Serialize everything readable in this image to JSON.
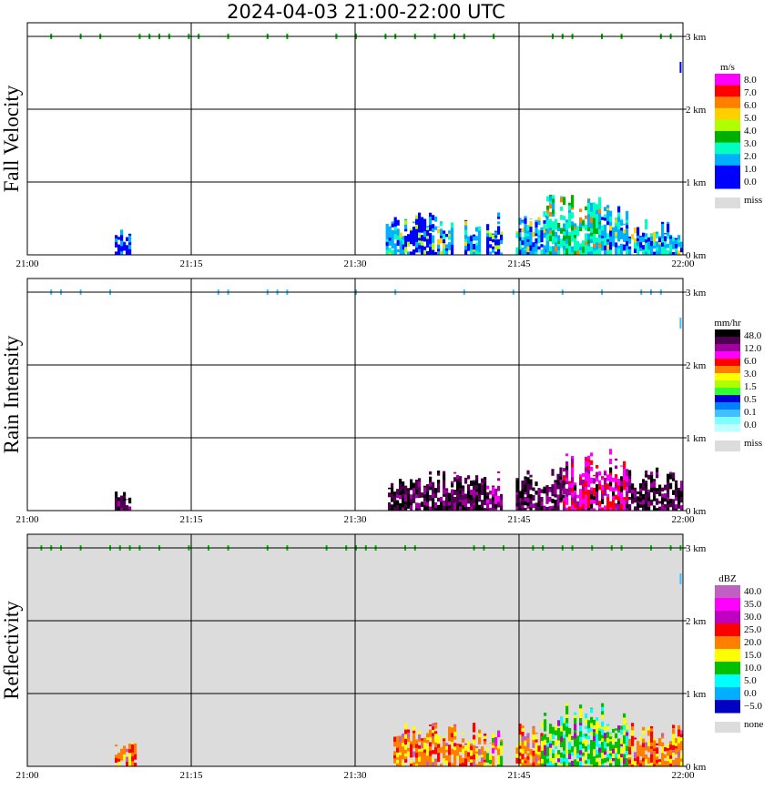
{
  "title": "2024-04-03  21:00-22:00 UTC",
  "colors": {
    "missing_gray": "#dcdcdc",
    "panel_border": "#000000",
    "background": "#ffffff"
  },
  "chart_data": [
    {
      "type": "heatmap",
      "title": "Fall Velocity",
      "ylabel": "Fall Velocity",
      "unit": "m/s",
      "x_ticks": [
        "21:00",
        "21:15",
        "21:30",
        "21:45",
        "22:00"
      ],
      "y_ticks": [
        "3 km",
        "2 km",
        "1 km",
        "0 km"
      ],
      "xlim": [
        "21:00",
        "22:00"
      ],
      "ylim_km": [
        0,
        3
      ],
      "grid": true,
      "background": "white",
      "colorbar": {
        "labels": [
          "8.0",
          "7.0",
          "6.0",
          "5.0",
          "4.0",
          "3.0",
          "2.0",
          "1.0",
          "0.0"
        ],
        "colors": [
          "#ff00ff",
          "#ff0000",
          "#ff7f00",
          "#ffd000",
          "#b0ff00",
          "#00b000",
          "#00ffc0",
          "#00b0ff",
          "#0000ff",
          "#0000ff"
        ],
        "missing_label": "miss"
      },
      "precip_blocks": [
        {
          "t0": 8.0,
          "t1": 9.3,
          "top": 0.35,
          "level": 8
        },
        {
          "t0": 32.8,
          "t1": 34.5,
          "top": 0.55,
          "level": 7
        },
        {
          "t0": 34.5,
          "t1": 37.5,
          "top": 0.6,
          "level": 8
        },
        {
          "t0": 37.5,
          "t1": 39.0,
          "top": 0.5,
          "level": 7
        },
        {
          "t0": 40.0,
          "t1": 41.5,
          "top": 0.55,
          "level": 7
        },
        {
          "t0": 42.0,
          "t1": 43.5,
          "top": 0.6,
          "level": 8
        },
        {
          "t0": 44.7,
          "t1": 47.5,
          "top": 0.6,
          "level": 7
        },
        {
          "t0": 47.5,
          "t1": 52.5,
          "top": 0.85,
          "level": 6
        },
        {
          "t0": 52.5,
          "t1": 55.0,
          "top": 0.8,
          "level": 7
        },
        {
          "t0": 55.0,
          "t1": 59.5,
          "top": 0.5,
          "level": 7
        },
        {
          "t0": 59.5,
          "t1": 60.0,
          "top": 0.35,
          "level": 7
        }
      ],
      "top_clutter": true
    },
    {
      "type": "heatmap",
      "title": "Rain Intensity",
      "ylabel": "Rain Intensity",
      "unit": "mm/hr",
      "x_ticks": [
        "21:00",
        "21:15",
        "21:30",
        "21:45",
        "22:00"
      ],
      "y_ticks": [
        "3 km",
        "2 km",
        "1 km",
        "0 km"
      ],
      "xlim": [
        "21:00",
        "22:00"
      ],
      "ylim_km": [
        0,
        3
      ],
      "grid": true,
      "background": "white",
      "colorbar": {
        "labels": [
          "48.0",
          "12.0",
          "6.0",
          "3.0",
          "1.5",
          "0.5",
          "0.1",
          "0.0"
        ],
        "colors": [
          "#000000",
          "#500050",
          "#a000a0",
          "#ff00ff",
          "#ff0000",
          "#ff8000",
          "#ffff00",
          "#b0ff00",
          "#30ff30",
          "#0000d0",
          "#0080ff",
          "#40c0ff",
          "#80ffff",
          "#c0ffff"
        ],
        "missing_label": "miss"
      },
      "precip_blocks": [
        {
          "t0": 8.0,
          "t1": 9.3,
          "top": 0.3,
          "level": 1
        },
        {
          "t0": 33.0,
          "t1": 42.0,
          "top": 0.55,
          "level": 1
        },
        {
          "t0": 42.0,
          "t1": 43.5,
          "top": 0.55,
          "level": 2
        },
        {
          "t0": 44.7,
          "t1": 49.0,
          "top": 0.6,
          "level": 1
        },
        {
          "t0": 49.0,
          "t1": 55.0,
          "top": 0.85,
          "level": 3
        },
        {
          "t0": 55.0,
          "t1": 60.0,
          "top": 0.6,
          "level": 1
        }
      ],
      "top_clutter": true
    },
    {
      "type": "heatmap",
      "title": "Reflectivity",
      "ylabel": "Reflectivity",
      "unit": "dBZ",
      "x_ticks": [
        "21:00",
        "21:15",
        "21:30",
        "21:45",
        "22:00"
      ],
      "y_ticks": [
        "3 km",
        "2 km",
        "1 km",
        "0 km"
      ],
      "xlim": [
        "21:00",
        "22:00"
      ],
      "ylim_km": [
        0,
        3
      ],
      "grid": true,
      "background": "gray",
      "colorbar": {
        "labels": [
          "40.0",
          "35.0",
          "30.0",
          "25.0",
          "20.0",
          "15.0",
          "10.0",
          "5.0",
          "0.0",
          "−5.0"
        ],
        "colors": [
          "#c060c0",
          "#ff00ff",
          "#c000c0",
          "#ff0000",
          "#ff8000",
          "#ffff00",
          "#00c000",
          "#00ffff",
          "#00b0ff",
          "#0000c0"
        ],
        "missing_label": "none"
      },
      "precip_blocks": [
        {
          "t0": 8.0,
          "t1": 10.0,
          "top": 0.35,
          "level": 4
        },
        {
          "t0": 33.5,
          "t1": 42.0,
          "top": 0.6,
          "level": 4
        },
        {
          "t0": 42.0,
          "t1": 43.5,
          "top": 0.55,
          "level": 5
        },
        {
          "t0": 44.7,
          "t1": 47.0,
          "top": 0.6,
          "level": 4
        },
        {
          "t0": 47.0,
          "t1": 55.0,
          "top": 0.9,
          "level": 6
        },
        {
          "t0": 55.0,
          "t1": 60.0,
          "top": 0.6,
          "level": 4
        }
      ],
      "top_clutter": true
    }
  ]
}
